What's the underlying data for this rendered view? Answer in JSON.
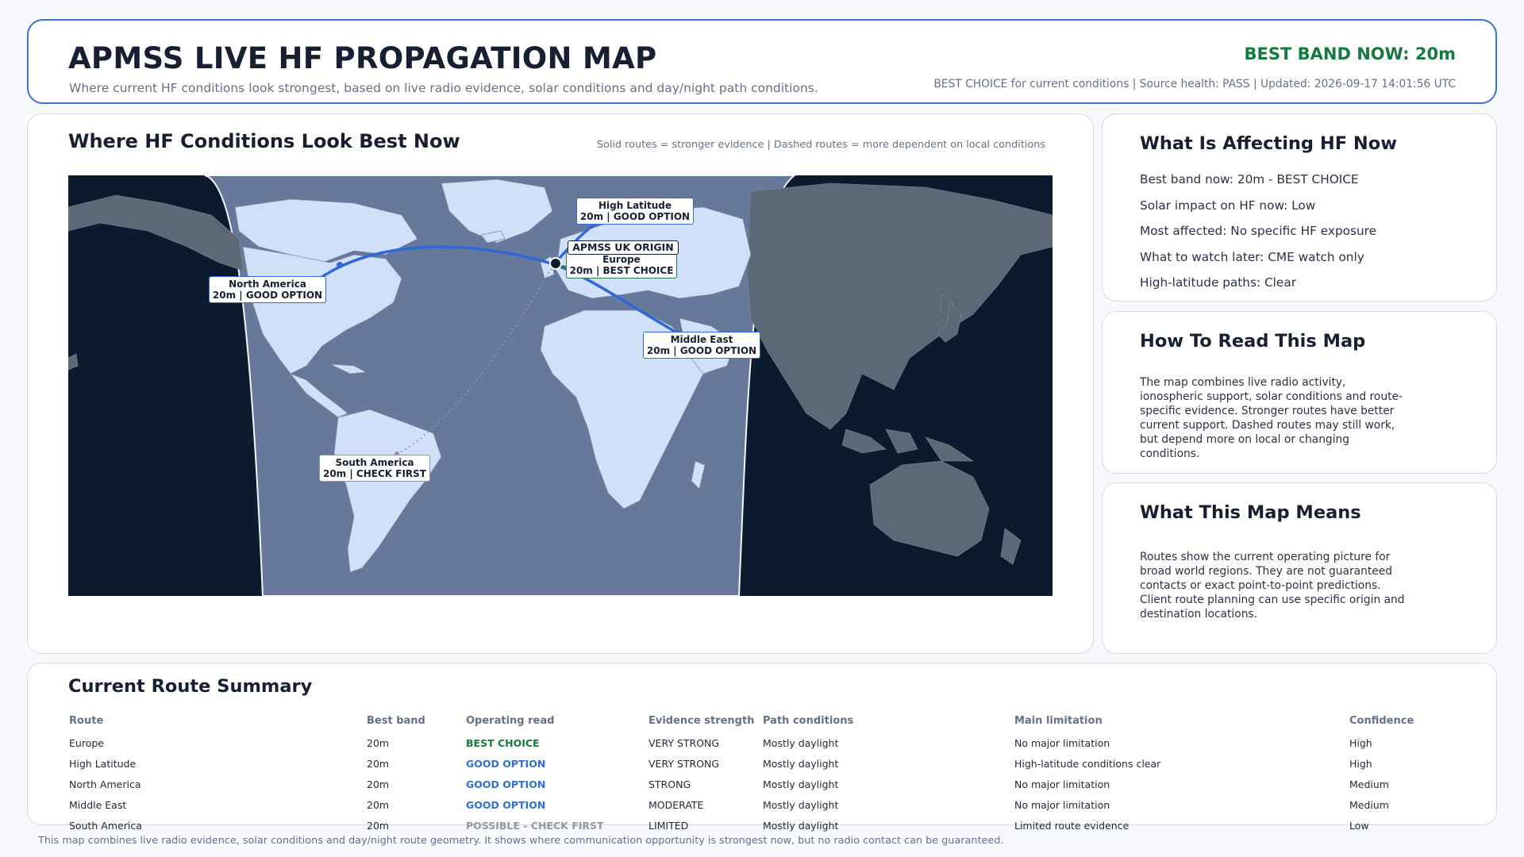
{
  "header": {
    "title": "APMSS LIVE HF PROPAGATION MAP",
    "subtitle": "Where current HF conditions look strongest, based on live radio evidence, solar conditions and day/night path conditions.",
    "best_band": "BEST BAND NOW: 20m",
    "status_line": "BEST CHOICE for current conditions | Source health: PASS | Updated: 2026-09-17 14:01:56 UTC"
  },
  "map": {
    "title": "Where HF Conditions Look Best Now",
    "legend": "Solid routes = stronger evidence | Dashed routes = more dependent on local conditions",
    "origin_label": "APMSS UK ORIGIN",
    "routes": [
      {
        "region": "High Latitude",
        "detail": "20m | GOOD OPTION"
      },
      {
        "region": "Europe",
        "detail": "20m | BEST CHOICE"
      },
      {
        "region": "North America",
        "detail": "20m | GOOD OPTION"
      },
      {
        "region": "Middle East",
        "detail": "20m | GOOD OPTION"
      },
      {
        "region": "South America",
        "detail": "20m | CHECK FIRST"
      }
    ],
    "colors": {
      "night": "#0c1a2e",
      "day": "#66799a",
      "land_day": "#cfe0f8",
      "land_night": "#5d6877",
      "solid_route": "#3068d8",
      "best": "#2f7a4a"
    }
  },
  "affecting": {
    "title": "What Is Affecting HF Now",
    "items": [
      "Best band now: 20m - BEST CHOICE",
      "Solar impact on HF now: Low",
      "Most affected: No specific HF exposure",
      "What to watch later: CME watch only",
      "High-latitude paths: Clear"
    ]
  },
  "howto": {
    "title": "How To Read This Map",
    "body": "The map combines live radio activity, ionospheric support, solar conditions and route-specific evidence. Stronger routes have better current support. Dashed routes may still work, but depend more on local or changing conditions."
  },
  "means": {
    "title": "What This Map Means",
    "body": "Routes show the current operating picture for broad world regions. They are not guaranteed contacts or exact point-to-point predictions. Client route planning can use specific origin and destination locations."
  },
  "summary": {
    "title": "Current Route Summary",
    "columns": [
      "Route",
      "Best band",
      "Operating read",
      "Evidence strength",
      "Path conditions",
      "Main limitation",
      "Confidence"
    ],
    "rows": [
      [
        "Europe",
        "20m",
        "BEST CHOICE",
        "VERY STRONG",
        "Mostly daylight",
        "No major limitation",
        "High"
      ],
      [
        "High Latitude",
        "20m",
        "GOOD OPTION",
        "VERY STRONG",
        "Mostly daylight",
        "High-latitude conditions clear",
        "High"
      ],
      [
        "North America",
        "20m",
        "GOOD OPTION",
        "STRONG",
        "Mostly daylight",
        "No major limitation",
        "Medium"
      ],
      [
        "Middle East",
        "20m",
        "GOOD OPTION",
        "MODERATE",
        "Mostly daylight",
        "No major limitation",
        "Medium"
      ],
      [
        "South America",
        "20m",
        "POSSIBLE - CHECK FIRST",
        "LIMITED",
        "Mostly daylight",
        "Limited route evidence",
        "Low"
      ]
    ]
  },
  "footer": "This map combines live radio evidence, solar conditions and day/night route geometry. It shows where communication opportunity is strongest now, but no radio contact can be guaranteed."
}
